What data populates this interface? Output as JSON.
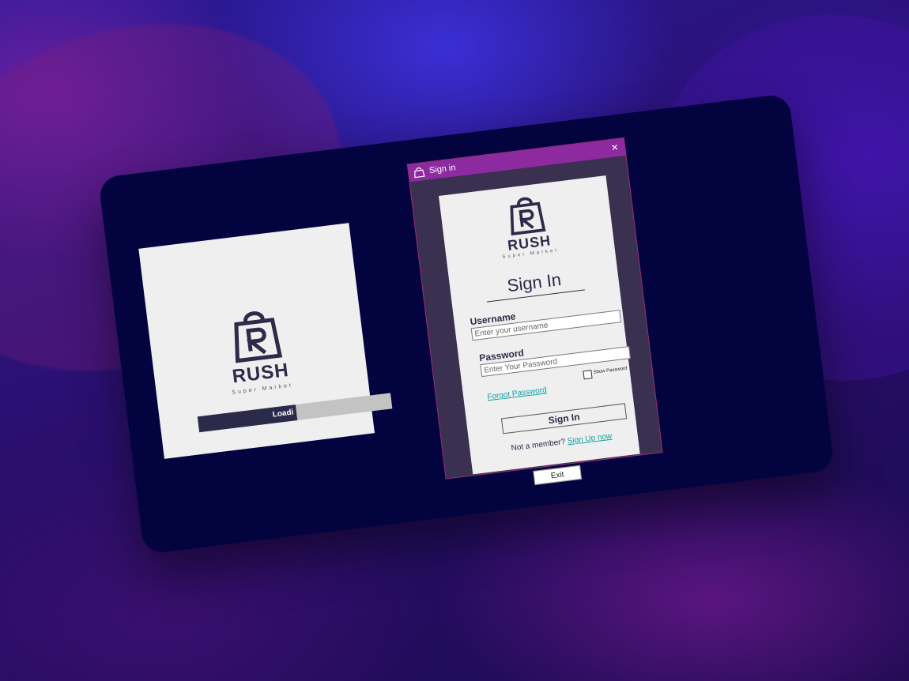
{
  "splash": {
    "brand": "RUSH",
    "tagline": "Super Market",
    "loading_text": "Loadi",
    "loading_progress_fraction": 0.51
  },
  "signin_window": {
    "title": "Sign in",
    "close_label": "×",
    "logo": {
      "brand": "RUSH",
      "tagline": "Super Market"
    },
    "heading": "Sign In",
    "username_label": "Username",
    "username_placeholder": "Enter your username",
    "password_label": "Password",
    "password_placeholder": "Enter Your Password",
    "show_password_label": "Show Password",
    "forgot_password_label": "Forgot Password",
    "signin_button_label": "Sign In",
    "not_member_text": "Not a member?",
    "signup_link_label": "Sign Up now",
    "exit_button_label": "Exit"
  },
  "colors": {
    "titlebar": "#8e2aa0",
    "window_bg": "#3a304f",
    "link": "#139fa0",
    "brand_dark": "#2d2a4a",
    "device_bg": "#03033f"
  },
  "icons": [
    "shopping-bag-logo-icon",
    "close-icon"
  ]
}
